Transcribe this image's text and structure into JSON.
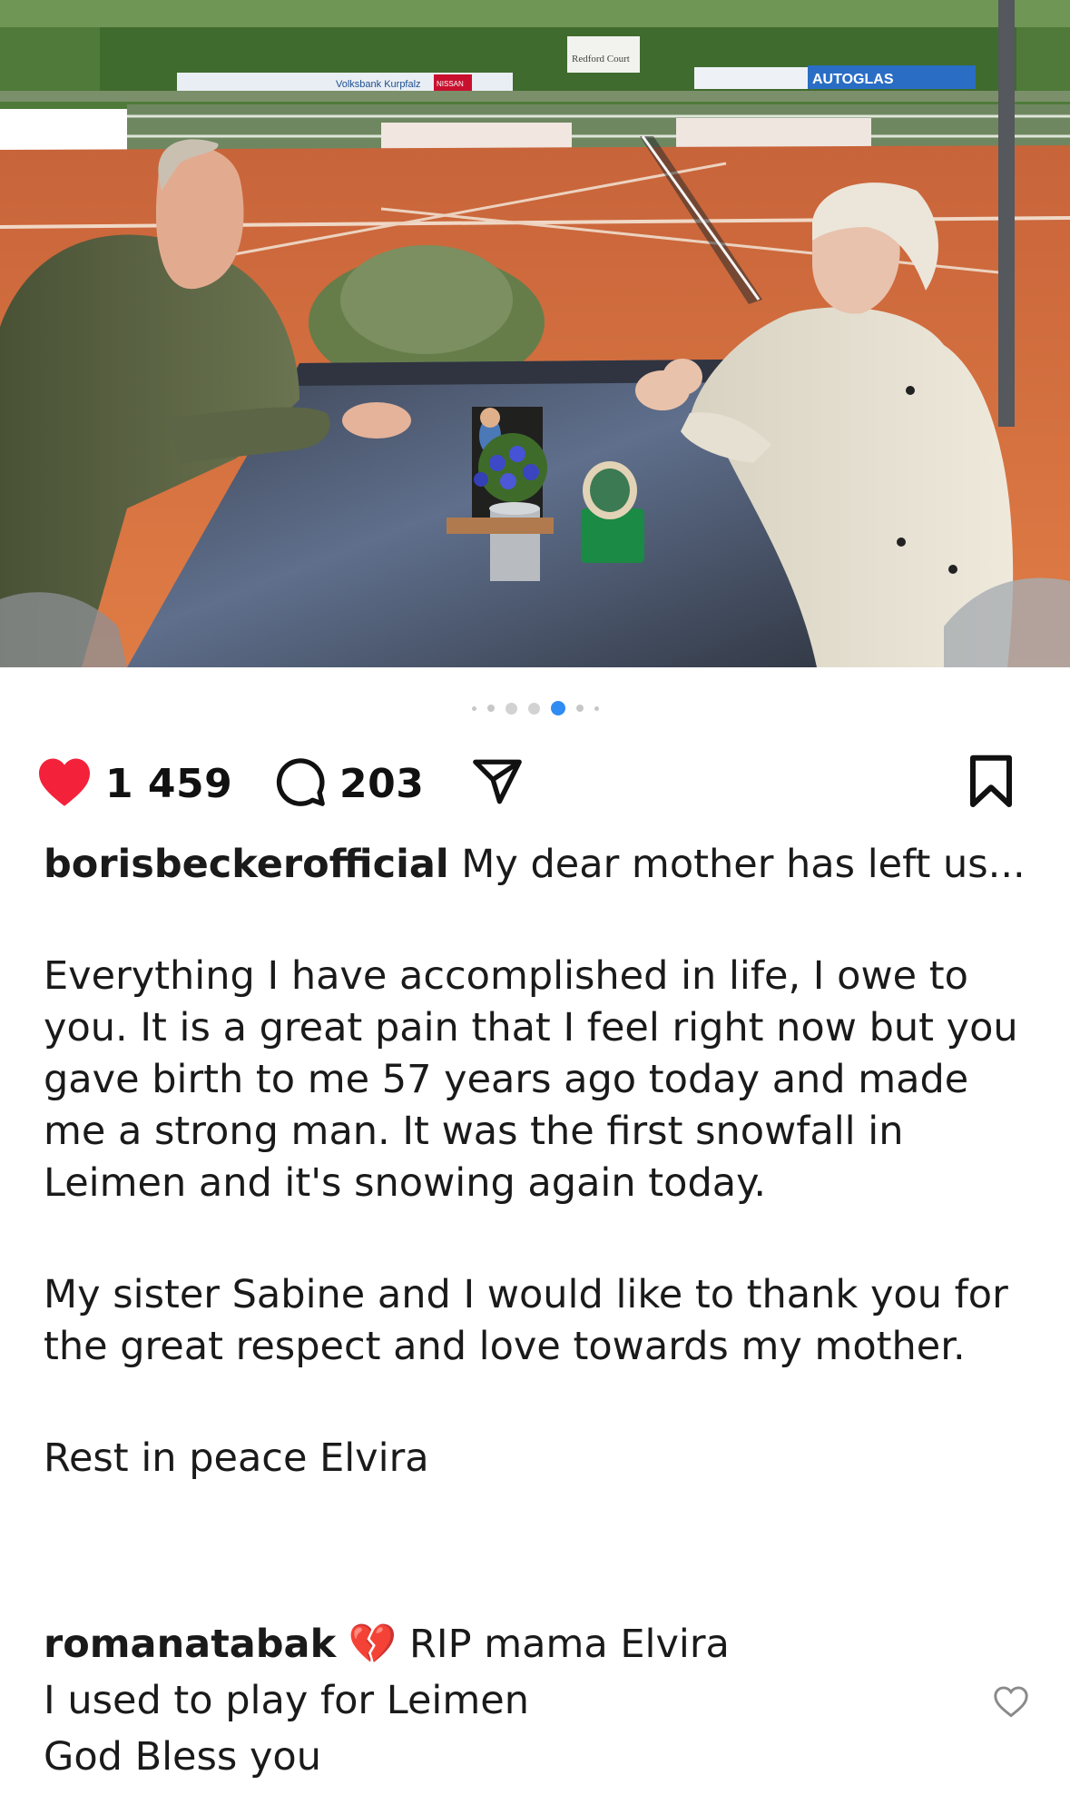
{
  "post": {
    "image_alt": "Photo of a man and an elderly woman sitting at a granite table by a clay tennis court",
    "court_signs": [
      "Volksbank Kurpfalz",
      "NISSAN",
      "Redford Court",
      "AUTOGLAS"
    ]
  },
  "carousel": {
    "count": 7,
    "active_index": 4
  },
  "actions": {
    "likes": "1 459",
    "comments": "203",
    "like_icon": "heart-filled-red",
    "comment_icon": "speech-bubble",
    "share_icon": "paper-plane",
    "save_icon": "bookmark"
  },
  "caption": {
    "username": "borisbeckerofficial",
    "first_line": " My dear mother has left us...",
    "paragraph_1": "Everything I have accomplished in life, I owe to you. It is a great pain that I feel right now but you gave birth to me 57 years ago today and made me a strong man. It was the first snowfall in Leimen and it's snowing again today.",
    "paragraph_2": "My sister Sabine and I would like to thank you for the great respect and love towards my mother.",
    "paragraph_3": "Rest in peace Elvira"
  },
  "top_comment": {
    "username": "romanatabak",
    "emoji": "💔",
    "line_1": " RIP mama Elvira",
    "line_2": "I used to play for Leimen",
    "line_3": "God Bless you"
  },
  "colors": {
    "like_red": "#f4213a",
    "active_dot": "#2f8cf2",
    "clay": "#d9703f"
  }
}
